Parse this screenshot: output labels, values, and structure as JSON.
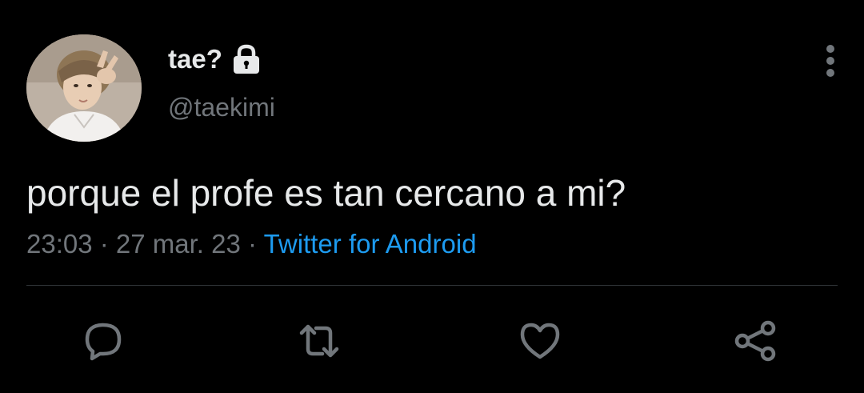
{
  "theme": {
    "background": "#000000",
    "primary_text": "#e7e9ea",
    "secondary_text": "#71767b",
    "link": "#1d9bf0",
    "divider": "#2f3336"
  },
  "author": {
    "display_name": "tae?",
    "handle": "@taekimi",
    "protected_icon": "lock-icon",
    "avatar": "avatar"
  },
  "tweet": {
    "text": "porque el profe es tan cercano a mi?",
    "time": "23:03",
    "separator_1": " · ",
    "date": "27 mar. 23",
    "separator_2": " · ",
    "source": "Twitter for Android"
  },
  "actions": [
    {
      "name": "reply",
      "icon": "reply-icon"
    },
    {
      "name": "retweet",
      "icon": "retweet-icon"
    },
    {
      "name": "like",
      "icon": "heart-icon"
    },
    {
      "name": "share",
      "icon": "share-icon"
    }
  ],
  "menu": {
    "icon": "more-vertical-icon"
  }
}
